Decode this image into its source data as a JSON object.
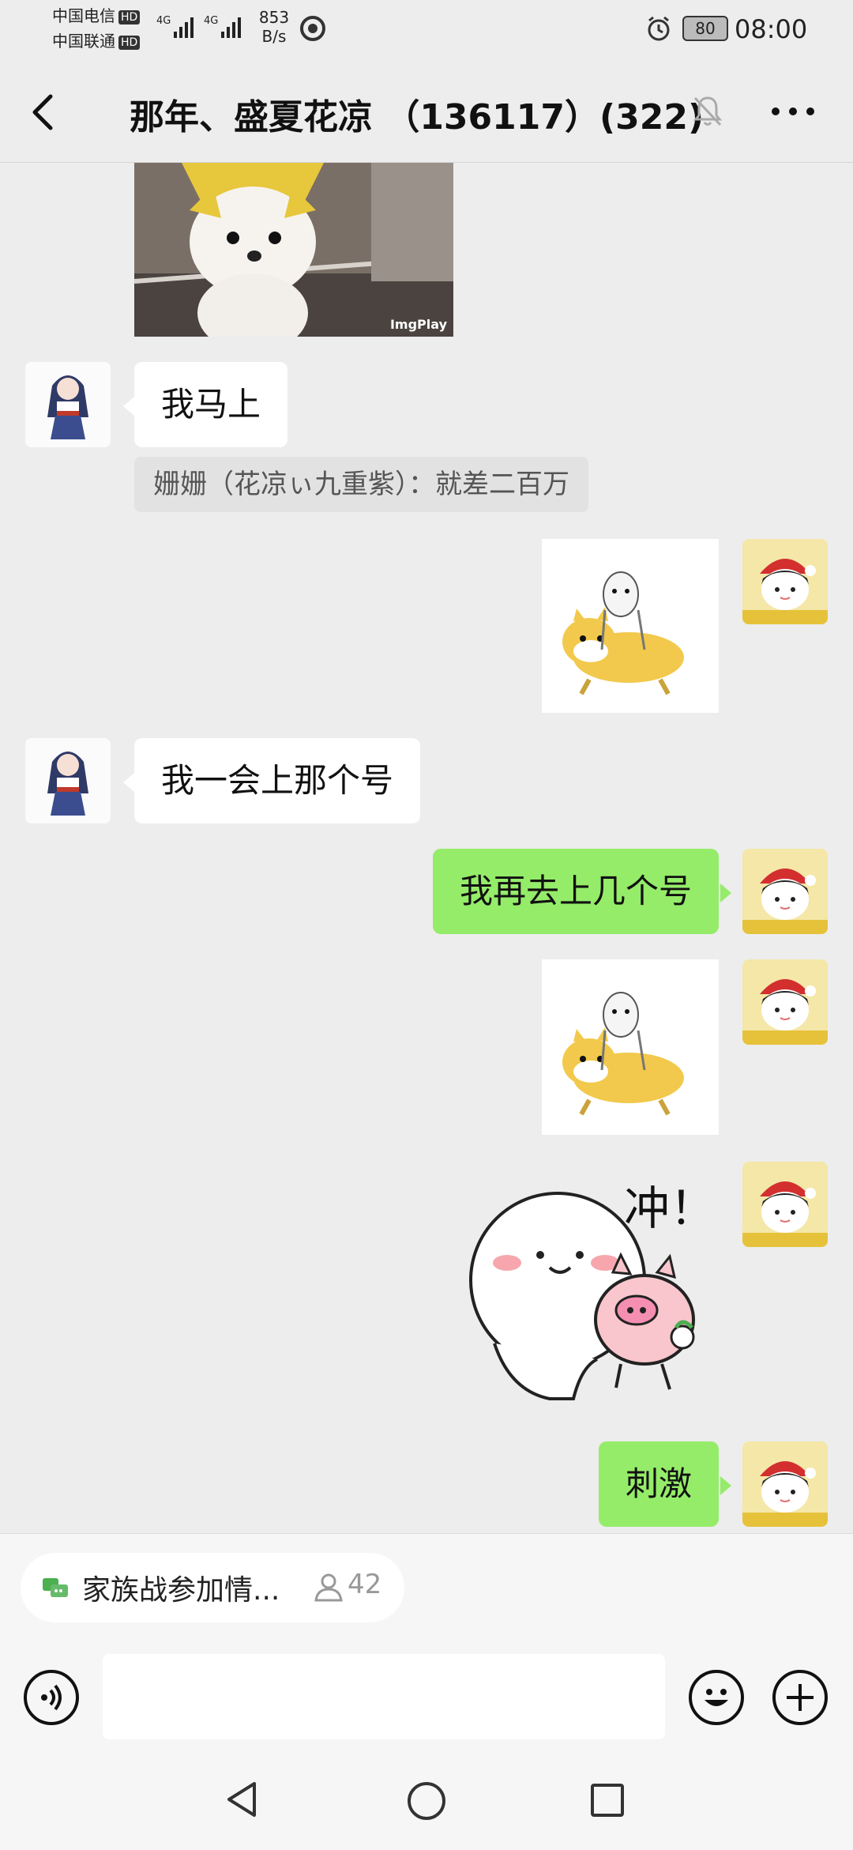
{
  "status_bar": {
    "carrier1": "中国电信",
    "carrier2": "中国联通",
    "hd": "HD",
    "net_type": "4G",
    "speed_value": "853",
    "speed_unit": "B/s",
    "battery": "80",
    "time": "08:00"
  },
  "header": {
    "title": "那年、盛夏花凉 （136117）(322)"
  },
  "messages": [
    {
      "side": "left",
      "text": "我马上"
    },
    {
      "quote": "姗姗（花凉ぃ九重紫）：就差二百万"
    },
    {
      "side": "left",
      "text": "我一会上那个号"
    },
    {
      "side": "right",
      "text": "我再去上几个号"
    },
    {
      "side": "right",
      "text": "刺激"
    }
  ],
  "stickers": {
    "dog_watermark": "ImgPlay",
    "chong_text": "冲！"
  },
  "group_notice": {
    "label": "家族战参加情...",
    "count": "42"
  },
  "colors": {
    "background": "#ededed",
    "outgoing_bubble": "#95ec69",
    "incoming_bubble": "#ffffff"
  }
}
